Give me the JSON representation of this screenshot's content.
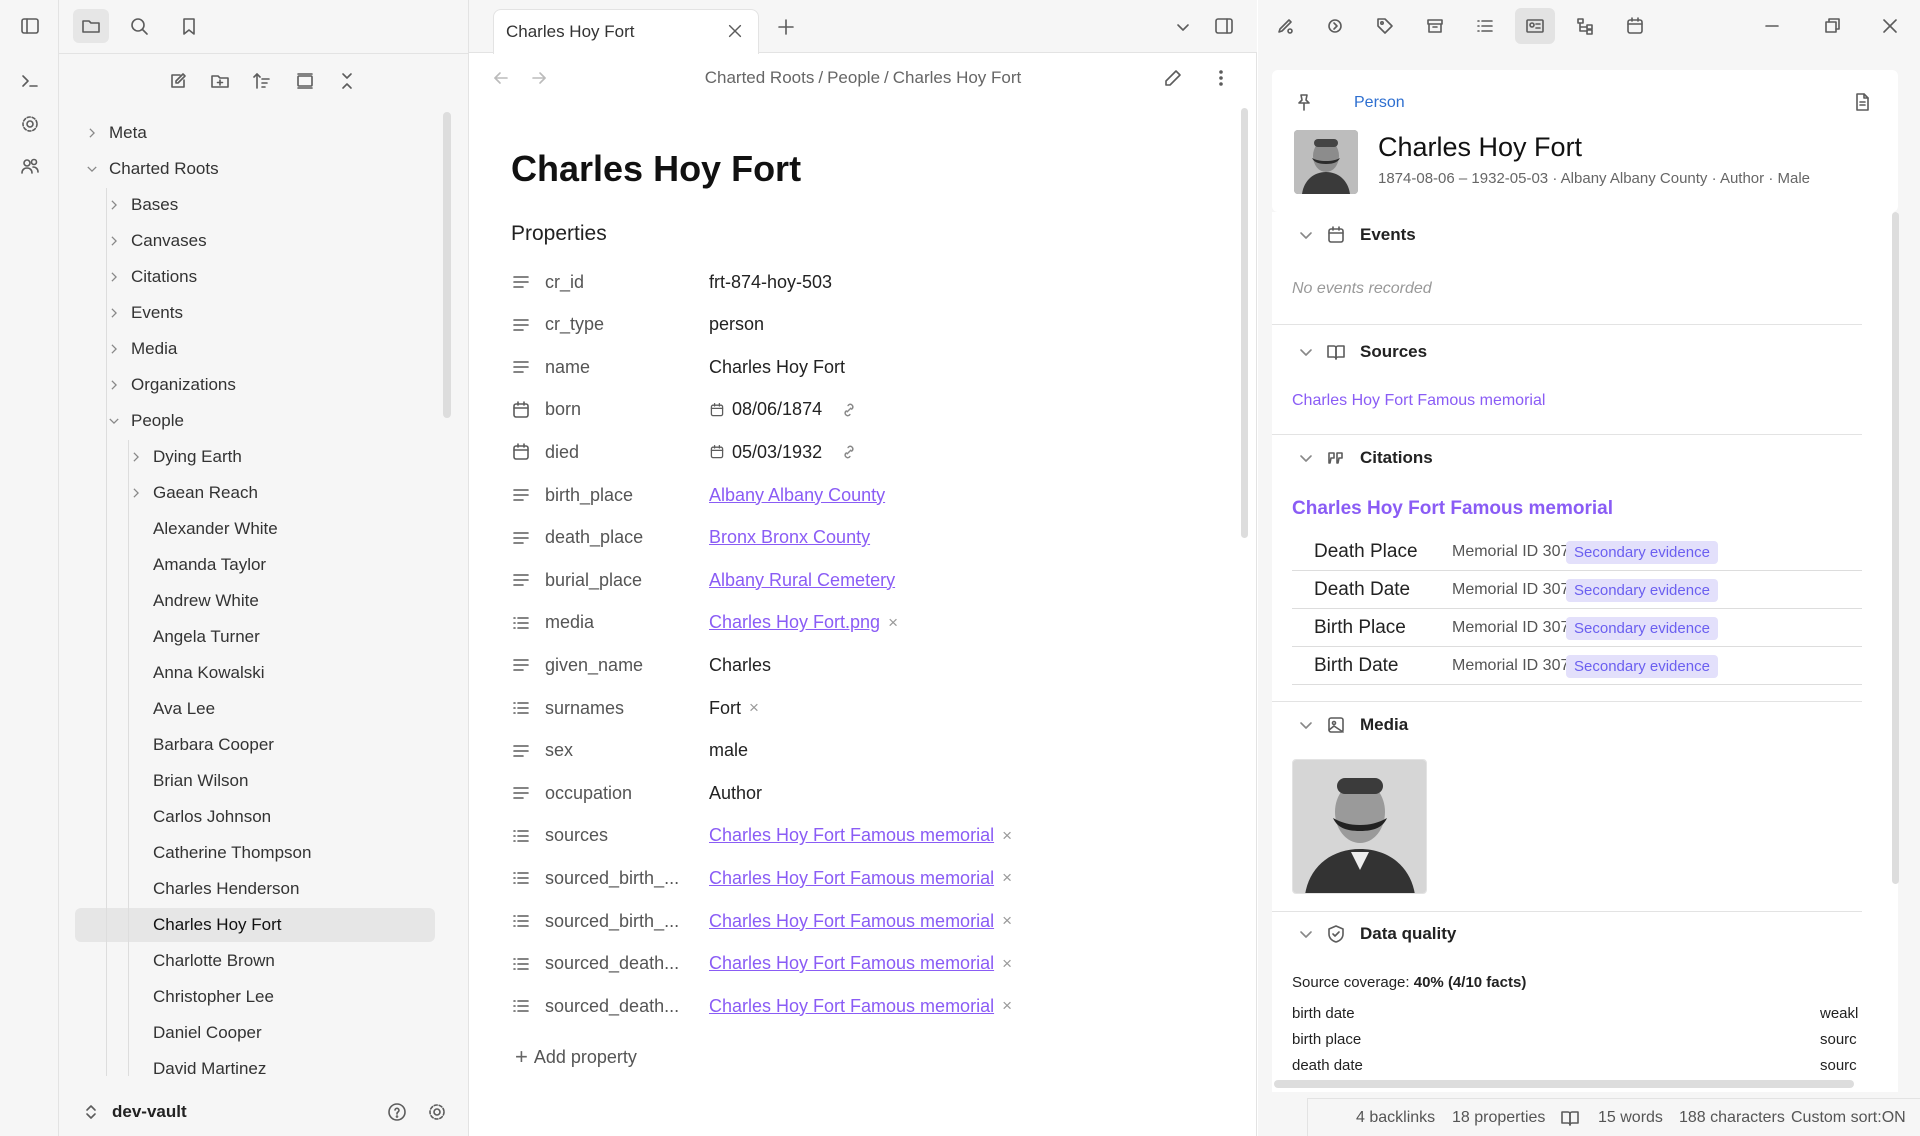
{
  "left_panel": {
    "vault_name": "dev-vault",
    "tree": [
      {
        "label": "Meta",
        "depth": 0,
        "expandable": true,
        "expanded": false
      },
      {
        "label": "Charted Roots",
        "depth": 0,
        "expandable": true,
        "expanded": true
      },
      {
        "label": "Bases",
        "depth": 1,
        "expandable": true,
        "expanded": false
      },
      {
        "label": "Canvases",
        "depth": 1,
        "expandable": true,
        "expanded": false
      },
      {
        "label": "Citations",
        "depth": 1,
        "expandable": true,
        "expanded": false
      },
      {
        "label": "Events",
        "depth": 1,
        "expandable": true,
        "expanded": false
      },
      {
        "label": "Media",
        "depth": 1,
        "expandable": true,
        "expanded": false
      },
      {
        "label": "Organizations",
        "depth": 1,
        "expandable": true,
        "expanded": false
      },
      {
        "label": "People",
        "depth": 1,
        "expandable": true,
        "expanded": true
      },
      {
        "label": "Dying Earth",
        "depth": 2,
        "expandable": true,
        "expanded": false
      },
      {
        "label": "Gaean Reach",
        "depth": 2,
        "expandable": true,
        "expanded": false
      },
      {
        "label": "Alexander White",
        "depth": 2,
        "expandable": false
      },
      {
        "label": "Amanda Taylor",
        "depth": 2,
        "expandable": false
      },
      {
        "label": "Andrew White",
        "depth": 2,
        "expandable": false
      },
      {
        "label": "Angela Turner",
        "depth": 2,
        "expandable": false
      },
      {
        "label": "Anna Kowalski",
        "depth": 2,
        "expandable": false
      },
      {
        "label": "Ava Lee",
        "depth": 2,
        "expandable": false
      },
      {
        "label": "Barbara Cooper",
        "depth": 2,
        "expandable": false
      },
      {
        "label": "Brian Wilson",
        "depth": 2,
        "expandable": false
      },
      {
        "label": "Carlos Johnson",
        "depth": 2,
        "expandable": false
      },
      {
        "label": "Catherine Thompson",
        "depth": 2,
        "expandable": false
      },
      {
        "label": "Charles Henderson",
        "depth": 2,
        "expandable": false
      },
      {
        "label": "Charles Hoy Fort",
        "depth": 2,
        "expandable": false,
        "selected": true
      },
      {
        "label": "Charlotte Brown",
        "depth": 2,
        "expandable": false
      },
      {
        "label": "Christopher Lee",
        "depth": 2,
        "expandable": false
      },
      {
        "label": "Daniel Cooper",
        "depth": 2,
        "expandable": false
      },
      {
        "label": "David Martinez",
        "depth": 2,
        "expandable": false
      }
    ]
  },
  "tab": {
    "title": "Charles Hoy Fort"
  },
  "breadcrumb": [
    "Charted Roots",
    "People",
    "Charles Hoy Fort"
  ],
  "note": {
    "title": "Charles Hoy Fort",
    "properties_heading": "Properties",
    "add_property": "Add property",
    "properties": [
      {
        "key": "cr_id",
        "value": "frt-874-hoy-503",
        "icon": "text",
        "kind": "text"
      },
      {
        "key": "cr_type",
        "value": "person",
        "icon": "text",
        "kind": "text"
      },
      {
        "key": "name",
        "value": "Charles Hoy Fort",
        "icon": "text",
        "kind": "text"
      },
      {
        "key": "born",
        "value": "08/06/1874",
        "icon": "calendar",
        "kind": "date"
      },
      {
        "key": "died",
        "value": "05/03/1932",
        "icon": "calendar",
        "kind": "date"
      },
      {
        "key": "birth_place",
        "value": "Albany Albany County",
        "icon": "text",
        "kind": "link"
      },
      {
        "key": "death_place",
        "value": "Bronx Bronx County",
        "icon": "text",
        "kind": "link"
      },
      {
        "key": "burial_place",
        "value": "Albany Rural Cemetery",
        "icon": "text",
        "kind": "link"
      },
      {
        "key": "media",
        "value": "Charles Hoy Fort.png",
        "icon": "list",
        "kind": "linklist"
      },
      {
        "key": "given_name",
        "value": "Charles",
        "icon": "text",
        "kind": "text"
      },
      {
        "key": "surnames",
        "value": "Fort",
        "icon": "list",
        "kind": "list"
      },
      {
        "key": "sex",
        "value": "male",
        "icon": "text",
        "kind": "text"
      },
      {
        "key": "occupation",
        "value": "Author",
        "icon": "text",
        "kind": "text"
      },
      {
        "key": "sources",
        "value": "Charles Hoy Fort Famous memorial",
        "icon": "list",
        "kind": "linklist"
      },
      {
        "key": "sourced_birth_...",
        "value": "Charles Hoy Fort Famous memorial",
        "icon": "list",
        "kind": "linklist"
      },
      {
        "key": "sourced_birth_...",
        "value": "Charles Hoy Fort Famous memorial",
        "icon": "list",
        "kind": "linklist"
      },
      {
        "key": "sourced_death...",
        "value": "Charles Hoy Fort Famous memorial",
        "icon": "list",
        "kind": "linklist"
      },
      {
        "key": "sourced_death...",
        "value": "Charles Hoy Fort Famous memorial",
        "icon": "list",
        "kind": "linklist"
      }
    ]
  },
  "person_card": {
    "type_label": "Person",
    "name": "Charles Hoy Fort",
    "birth": "1874-08-06",
    "dash": "–",
    "death": "1932-05-03",
    "place": "Albany Albany County",
    "occupation": "Author",
    "sex": "Male",
    "dot": "·"
  },
  "sections": {
    "events": {
      "title": "Events",
      "empty": "No events recorded"
    },
    "sources": {
      "title": "Sources",
      "link": "Charles Hoy Fort Famous memorial"
    },
    "citations": {
      "title": "Citations",
      "source": "Charles Hoy Fort Famous memorial",
      "rows": [
        {
          "fact": "Death Place",
          "memorial": "Memorial ID 3079",
          "badge": "Secondary evidence"
        },
        {
          "fact": "Death Date",
          "memorial": "Memorial ID 3079",
          "badge": "Secondary evidence"
        },
        {
          "fact": "Birth Place",
          "memorial": "Memorial ID 3079",
          "badge": "Secondary evidence"
        },
        {
          "fact": "Birth Date",
          "memorial": "Memorial ID 3079",
          "badge": "Secondary evidence"
        }
      ]
    },
    "media": {
      "title": "Media"
    },
    "data_quality": {
      "title": "Data quality",
      "coverage_label": "Source coverage:",
      "coverage_value": "40% (4/10 facts)",
      "facts": [
        {
          "label": "birth date",
          "status": "weakl"
        },
        {
          "label": "birth place",
          "status": "sourc"
        },
        {
          "label": "death date",
          "status": "sourc"
        }
      ]
    }
  },
  "status_bar": {
    "backlinks": "4 backlinks",
    "properties": "18 properties",
    "words": "15 words",
    "characters": "188 characters",
    "sort": "Custom sort:ON"
  },
  "colors": {
    "accent": "#8a5cf5",
    "link_blue": "#2e6fd0",
    "badge_bg": "#e3e0fb",
    "badge_text": "#6b5ff0"
  }
}
